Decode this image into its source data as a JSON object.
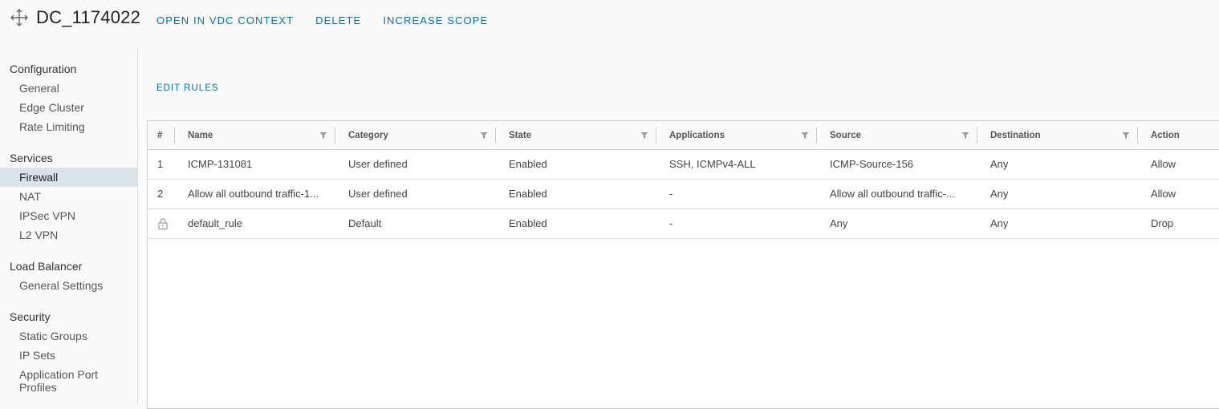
{
  "header": {
    "title": "DC_1174022",
    "icon": "edge-gateway-icon",
    "actions": [
      "OPEN IN VDC CONTEXT",
      "DELETE",
      "INCREASE SCOPE"
    ]
  },
  "sidebar": {
    "sections": [
      {
        "label": "Configuration",
        "items": [
          "General",
          "Edge Cluster",
          "Rate Limiting"
        ]
      },
      {
        "label": "Services",
        "items": [
          "Firewall",
          "NAT",
          "IPSec VPN",
          "L2 VPN"
        ]
      },
      {
        "label": "Load Balancer",
        "items": [
          "General Settings"
        ]
      },
      {
        "label": "Security",
        "items": [
          "Static Groups",
          "IP Sets",
          "Application Port",
          "Profiles"
        ]
      }
    ],
    "active_item": "Firewall"
  },
  "main": {
    "edit_rules_label": "EDIT RULES",
    "columns": [
      "#",
      "Name",
      "Category",
      "State",
      "Applications",
      "Source",
      "Destination",
      "Action"
    ],
    "rows": [
      {
        "num": "1",
        "name": "ICMP-131081",
        "category": "User defined",
        "state": "Enabled",
        "applications": "SSH, ICMPv4-ALL",
        "source": "ICMP-Source-156",
        "destination": "Any",
        "action": "Allow"
      },
      {
        "num": "2",
        "name": "Allow all outbound traffic-1...",
        "category": "User defined",
        "state": "Enabled",
        "applications": "-",
        "source": "Allow all outbound traffic-...",
        "destination": "Any",
        "action": "Allow"
      },
      {
        "num": "",
        "name": "default_rule",
        "category": "Default",
        "state": "Enabled",
        "applications": "-",
        "source": "Any",
        "destination": "Any",
        "action": "Drop",
        "locked": true
      }
    ]
  },
  "colors": {
    "link": "#0072a3",
    "active_nav_bg": "#d9e4ea"
  }
}
